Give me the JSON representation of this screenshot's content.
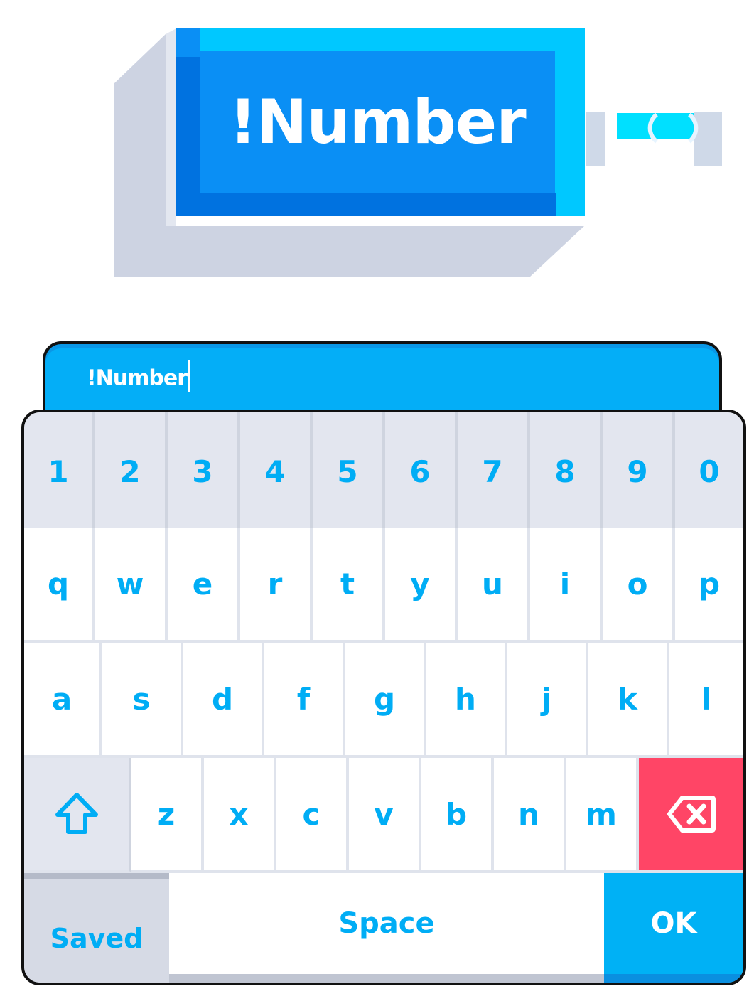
{
  "preview": {
    "title": "!Number"
  },
  "input": {
    "value": "!Number"
  },
  "keyboard": {
    "number_row": [
      "1",
      "2",
      "3",
      "4",
      "5",
      "6",
      "7",
      "8",
      "9",
      "0"
    ],
    "row_q": [
      "q",
      "w",
      "e",
      "r",
      "t",
      "y",
      "u",
      "i",
      "o",
      "p"
    ],
    "row_a": [
      "a",
      "s",
      "d",
      "f",
      "g",
      "h",
      "j",
      "k",
      "l"
    ],
    "row_z": [
      "z",
      "x",
      "c",
      "v",
      "b",
      "n",
      "m"
    ],
    "shift_icon": "shift-arrow-icon",
    "backspace_icon": "backspace-icon",
    "saved_label": "Saved",
    "space_label": "Space",
    "ok_label": "OK"
  },
  "colors": {
    "accent": "#00adf5",
    "preview_blue": "#0a8ff5",
    "preview_cyan": "#00c8ff",
    "backspace_red": "#ff4566",
    "ok_blue": "#00b1f5"
  }
}
